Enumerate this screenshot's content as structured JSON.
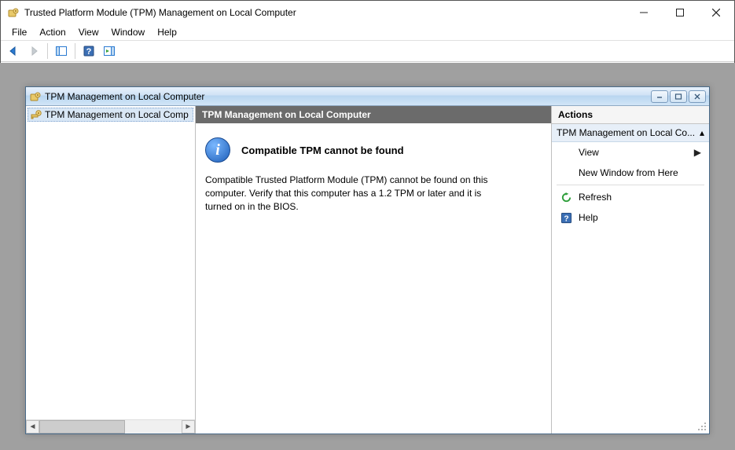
{
  "window": {
    "title": "Trusted Platform Module (TPM) Management on Local Computer"
  },
  "menu": {
    "file": "File",
    "action": "Action",
    "view": "View",
    "window": "Window",
    "help": "Help"
  },
  "child": {
    "title": "TPM Management on Local Computer"
  },
  "tree": {
    "item_label": "TPM Management on Local Comp"
  },
  "content": {
    "heading": "TPM Management on Local Computer",
    "info_title": "Compatible TPM cannot be found",
    "info_text": "Compatible Trusted Platform Module (TPM) cannot be found on this computer. Verify that this computer has a 1.2 TPM or later and it is turned on in the BIOS."
  },
  "actions": {
    "panel_title": "Actions",
    "section_title": "TPM Management on Local Co...",
    "view": "View",
    "new_window": "New Window from Here",
    "refresh": "Refresh",
    "help": "Help"
  }
}
